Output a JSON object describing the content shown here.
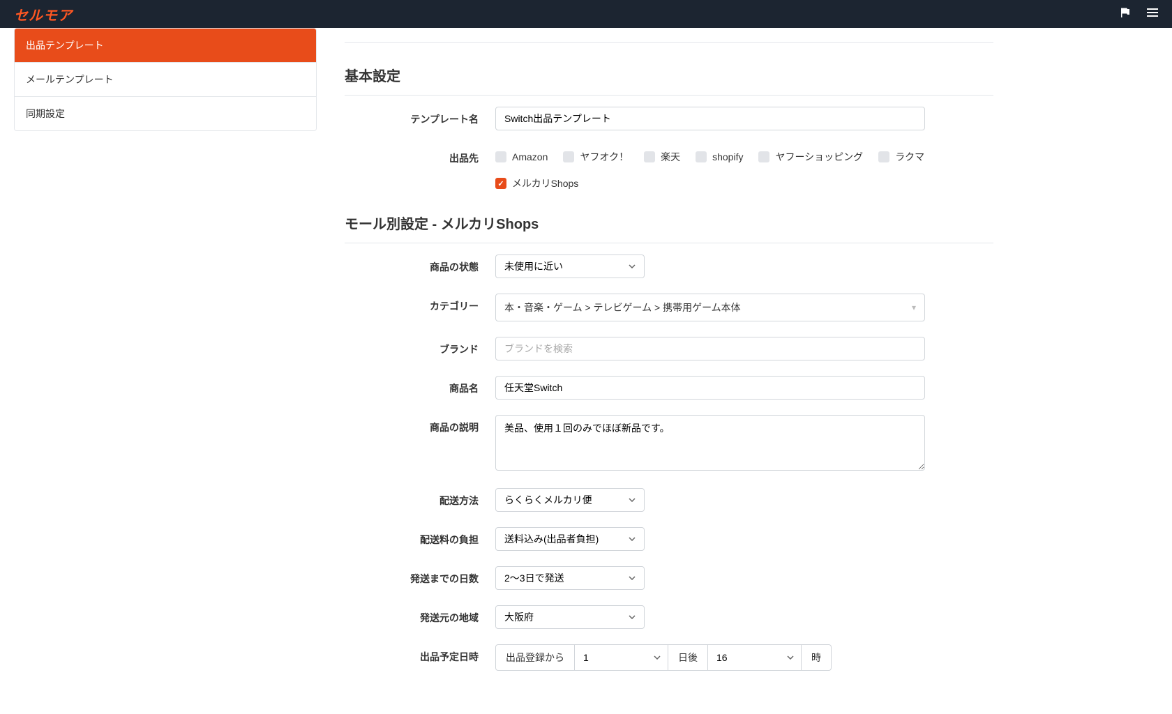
{
  "header": {
    "logo": "セルモア"
  },
  "sidebar": {
    "items": [
      {
        "label": "出品テンプレート",
        "active": true
      },
      {
        "label": "メールテンプレート",
        "active": false
      },
      {
        "label": "同期設定",
        "active": false
      }
    ]
  },
  "basic": {
    "title": "基本設定",
    "template_name_label": "テンプレート名",
    "template_name_value": "Switch出品テンプレート",
    "destination_label": "出品先",
    "destinations": [
      {
        "label": "Amazon",
        "checked": false
      },
      {
        "label": "ヤフオク！",
        "checked": false
      },
      {
        "label": "楽天",
        "checked": false
      },
      {
        "label": "shopify",
        "checked": false
      },
      {
        "label": "ヤフーショッピング",
        "checked": false
      },
      {
        "label": "ラクマ",
        "checked": false
      },
      {
        "label": "メルカリShops",
        "checked": true
      }
    ]
  },
  "mall": {
    "title": "モール別設定 - メルカリShops",
    "condition_label": "商品の状態",
    "condition_value": "未使用に近い",
    "category_label": "カテゴリー",
    "category_value": "本・音楽・ゲーム > テレビゲーム > 携帯用ゲーム本体",
    "brand_label": "ブランド",
    "brand_placeholder": "ブランドを検索",
    "name_label": "商品名",
    "name_value": "任天堂Switch",
    "desc_label": "商品の説明",
    "desc_value": "美品、使用１回のみでほぼ新品です。",
    "shipmethod_label": "配送方法",
    "shipmethod_value": "らくらくメルカリ便",
    "shipfee_label": "配送料の負担",
    "shipfee_value": "送料込み(出品者負担)",
    "shipdays_label": "発送までの日数",
    "shipdays_value": "2〜3日で発送",
    "shipfrom_label": "発送元の地域",
    "shipfrom_value": "大阪府",
    "schedule_label": "出品予定日時",
    "schedule_prefix": "出品登録から",
    "schedule_days_value": "1",
    "schedule_days_suffix": "日後",
    "schedule_hour_value": "16",
    "schedule_hour_suffix": "時"
  }
}
